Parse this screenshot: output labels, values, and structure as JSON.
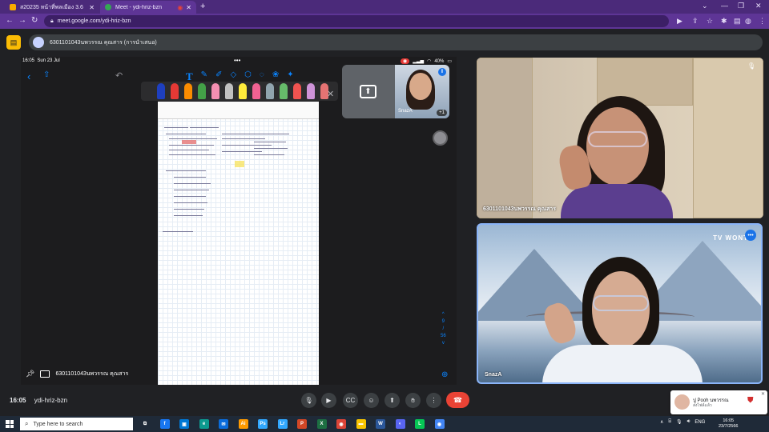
{
  "browser": {
    "tabs": [
      {
        "title": "ส20235 หน้าที่พลเมือง 3.6",
        "favicon_color": "#f9ab00"
      },
      {
        "title": "Meet - ydi-hriz-bzn",
        "favicon_color": "#34a853"
      }
    ],
    "new_tab": "+",
    "url": "meet.google.com/ydi-hriz-bzn"
  },
  "presentation": {
    "label": "6301101043นพวรรณ คุณสาร (การนำเสนอ)"
  },
  "ipad": {
    "time": "16:05",
    "date": "Sun 23 Jul",
    "battery": "40%",
    "dots": "•••",
    "page_indicator": [
      "^",
      "9",
      "/",
      "56",
      "v"
    ],
    "presenter_label": "6301101043นพวรรณ คุณสาร",
    "pen_colors": [
      "#1e3fbf",
      "#e53935",
      "#fb8c00",
      "#43a047",
      "#f48fb1",
      "#ffeb3b",
      "#f06292",
      "#ffee58",
      "#90a4ae",
      "#ef5350",
      "#66bb6a",
      "#ce93d8",
      "#e57373"
    ]
  },
  "self_tile": {
    "name": "SnazA",
    "others_badge": "+1"
  },
  "participants": [
    {
      "name": "6301101043นพวรรณ คุณสาร",
      "muted": true
    },
    {
      "name": "SnazA",
      "logo_text": "TV WONT"
    }
  ],
  "callbar": {
    "time": "16:05",
    "meeting_code": "ydi-hriz-bzn"
  },
  "notification": {
    "sender": "ปู Pooh นพวรรณ",
    "message": "ส่งไฟล์แล้ว"
  },
  "taskbar": {
    "search_placeholder": "Type here to search",
    "language": "ENG",
    "clock_time": "16:05",
    "clock_date": "23/7/2566",
    "apps": [
      {
        "name": "task-view",
        "color": "#1f2a38",
        "glyph": "⧉"
      },
      {
        "name": "facebook",
        "color": "#1877f2",
        "glyph": "f"
      },
      {
        "name": "store",
        "color": "#0078d4",
        "glyph": "▣"
      },
      {
        "name": "edge",
        "color": "#0c9a8f",
        "glyph": "e"
      },
      {
        "name": "mail",
        "color": "#0a6cdb",
        "glyph": "✉"
      },
      {
        "name": "illustrator",
        "color": "#ff9a00",
        "glyph": "Ai"
      },
      {
        "name": "photoshop",
        "color": "#31a8ff",
        "glyph": "Ps"
      },
      {
        "name": "lightroom",
        "color": "#31a8ff",
        "glyph": "Lr"
      },
      {
        "name": "powerpoint",
        "color": "#d24726",
        "glyph": "P"
      },
      {
        "name": "excel",
        "color": "#1d6f42",
        "glyph": "X"
      },
      {
        "name": "chrome",
        "color": "#db4437",
        "glyph": "◉"
      },
      {
        "name": "files",
        "color": "#f8c400",
        "glyph": "▬"
      },
      {
        "name": "word",
        "color": "#2b579a",
        "glyph": "W"
      },
      {
        "name": "discord",
        "color": "#5865f2",
        "glyph": "◐"
      },
      {
        "name": "line",
        "color": "#06c755",
        "glyph": "L"
      },
      {
        "name": "chrome-active",
        "color": "#4285f4",
        "glyph": "◉"
      }
    ]
  }
}
